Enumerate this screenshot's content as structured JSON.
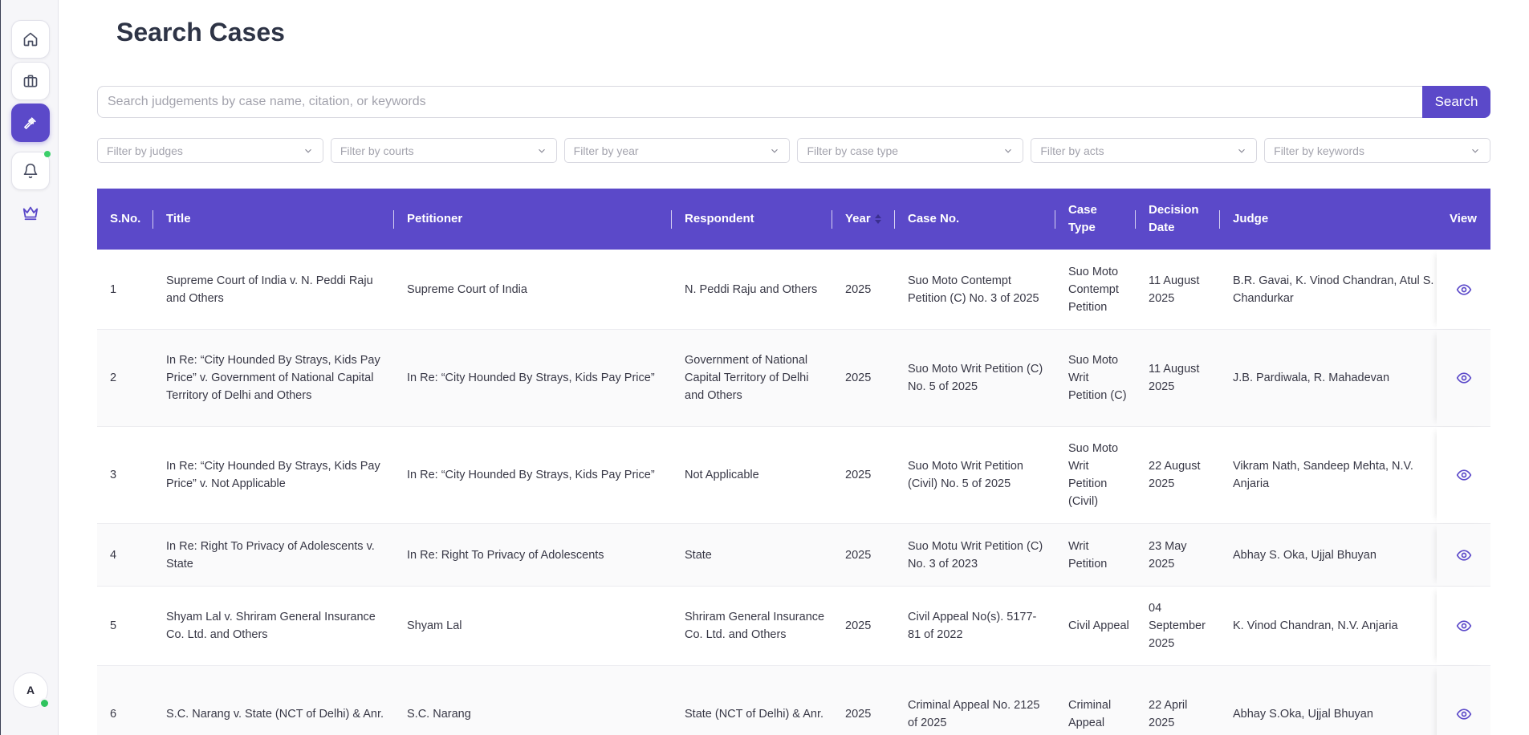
{
  "page": {
    "title": "Search Cases"
  },
  "search": {
    "placeholder": "Search judgements by case name, citation, or keywords",
    "value": "",
    "button_label": "Search"
  },
  "filters": [
    {
      "placeholder": "Filter by judges"
    },
    {
      "placeholder": "Filter by courts"
    },
    {
      "placeholder": "Filter by year"
    },
    {
      "placeholder": "Filter by case type"
    },
    {
      "placeholder": "Filter by acts"
    },
    {
      "placeholder": "Filter by keywords"
    }
  ],
  "sidebar": {
    "items": [
      {
        "icon": "home-icon",
        "active": false
      },
      {
        "icon": "briefcase-icon",
        "active": false
      },
      {
        "icon": "gavel-icon",
        "active": true
      },
      {
        "icon": "bell-icon",
        "active": false,
        "has_notification": true
      },
      {
        "icon": "crown-icon",
        "active": false
      }
    ],
    "avatar_initial": "A"
  },
  "table": {
    "headers": {
      "sno": "S.No.",
      "title": "Title",
      "petitioner": "Petitioner",
      "respondent": "Respondent",
      "year": "Year",
      "case_no": "Case No.",
      "case_type": "Case Type",
      "decision_date": "Decision Date",
      "judge": "Judge",
      "view": "View"
    },
    "rows": [
      {
        "sno": "1",
        "title": "Supreme Court of India v. N. Peddi Raju and Others",
        "petitioner": "Supreme Court of India",
        "respondent": "N. Peddi Raju and Others",
        "year": "2025",
        "case_no": "Suo Moto Contempt Petition (C) No. 3 of 2025",
        "case_type": "Suo Moto Contempt Petition",
        "decision_date": "11 August 2025",
        "judge": "B.R. Gavai, K. Vinod Chandran, Atul S. Chandurkar"
      },
      {
        "sno": "2",
        "title": "In Re: “City Hounded By Strays, Kids Pay Price” v. Government of National Capital Territory of Delhi and Others",
        "petitioner": "In Re: “City Hounded By Strays, Kids Pay Price”",
        "respondent": "Government of National Capital Territory of Delhi and Others",
        "year": "2025",
        "case_no": "Suo Moto Writ Petition (C) No. 5 of 2025",
        "case_type": "Suo Moto Writ Petition (C)",
        "decision_date": "11 August 2025",
        "judge": "J.B. Pardiwala, R. Mahadevan"
      },
      {
        "sno": "3",
        "title": "In Re: “City Hounded By Strays, Kids Pay Price” v. Not Applicable",
        "petitioner": "In Re: “City Hounded By Strays, Kids Pay Price”",
        "respondent": "Not Applicable",
        "year": "2025",
        "case_no": "Suo Moto Writ Petition (Civil) No. 5 of 2025",
        "case_type": "Suo Moto Writ Petition (Civil)",
        "decision_date": "22 August 2025",
        "judge": "Vikram Nath, Sandeep Mehta, N.V. Anjaria"
      },
      {
        "sno": "4",
        "title": "In Re: Right To Privacy of Adolescents v. State",
        "petitioner": "In Re: Right To Privacy of Adolescents",
        "respondent": "State",
        "year": "2025",
        "case_no": "Suo Motu Writ Petition (C) No. 3 of 2023",
        "case_type": "Writ Petition",
        "decision_date": "23 May 2025",
        "judge": "Abhay S. Oka, Ujjal Bhuyan"
      },
      {
        "sno": "5",
        "title": "Shyam Lal v. Shriram General Insurance Co. Ltd. and Others",
        "petitioner": "Shyam Lal",
        "respondent": "Shriram General Insurance Co. Ltd. and Others",
        "year": "2025",
        "case_no": "Civil Appeal No(s). 5177-81 of 2022",
        "case_type": "Civil Appeal",
        "decision_date": "04 September 2025",
        "judge": "K. Vinod Chandran, N.V. Anjaria"
      },
      {
        "sno": "6",
        "title": "S.C. Narang v. State (NCT of Delhi) & Anr.",
        "petitioner": "S.C. Narang",
        "respondent": "State (NCT of Delhi) & Anr.",
        "year": "2025",
        "case_no": "Criminal Appeal No. 2125 of 2025",
        "case_type": "Criminal Appeal",
        "decision_date": "22 April 2025",
        "judge": "Abhay S.Oka, Ujjal Bhuyan"
      }
    ]
  },
  "colors": {
    "accent": "#5b49c9",
    "online": "#2fc35e"
  }
}
